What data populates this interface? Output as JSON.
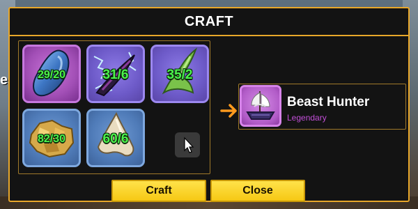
{
  "background": {
    "left_text": "ea"
  },
  "dialog": {
    "title": "CRAFT"
  },
  "ingredients": [
    {
      "icon": "blue-gem-icon",
      "count": "29/20",
      "rarity_color": "#a24fb6"
    },
    {
      "icon": "electric-fang-icon",
      "count": "31/6",
      "rarity_color": "#6d5ac8"
    },
    {
      "icon": "green-fang-icon",
      "count": "35/2",
      "rarity_color": "#6d5ac8"
    },
    {
      "icon": "gold-ore-icon",
      "count": "82/30",
      "rarity_color": "#4f7bb8"
    },
    {
      "icon": "shark-tooth-icon",
      "count": "60/6",
      "rarity_color": "#4f7bb8"
    }
  ],
  "result": {
    "icon": "ship-icon",
    "name": "Beast Hunter",
    "rarity": "Legendary",
    "rarity_color": "#c24fd8"
  },
  "buttons": {
    "craft": "Craft",
    "close": "Close"
  },
  "colors": {
    "accent_border": "#e8a72a",
    "button_yellow": "#f6c814",
    "count_green": "#4cf24c",
    "panel_bg": "#131313"
  }
}
